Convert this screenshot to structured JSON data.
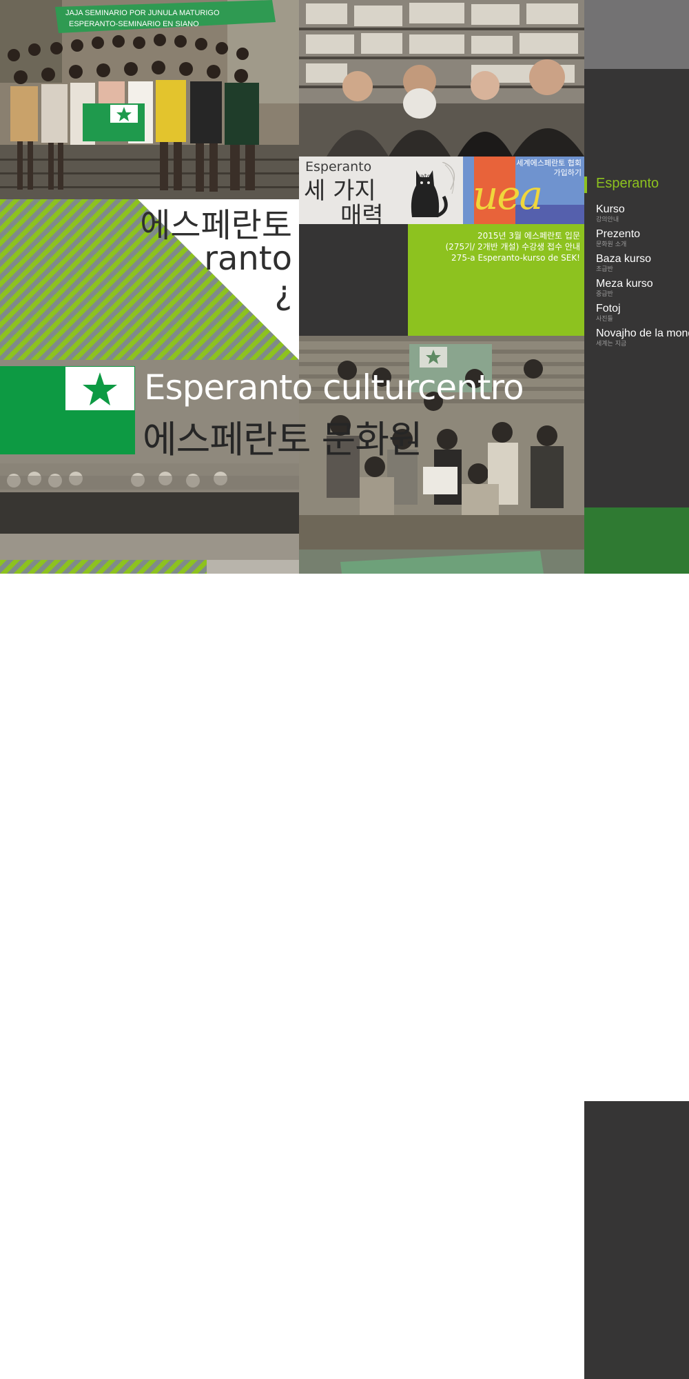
{
  "group_photo": {
    "banner_text_line1": "JAJA SEMINARIO POR JUNULA MATURIGO",
    "banner_text_line2": "ESPERANTO-SEMINARIO EN SIANO"
  },
  "tile_three": {
    "latin": "Esperanto",
    "korean_line1": "세 가지",
    "korean_line2": "매력",
    "cat_caption": "kato"
  },
  "tile_uea": {
    "logo_text": "uea",
    "korean_line1": "세계에스페란토 협회",
    "korean_line2": "가입하기"
  },
  "tile_course": {
    "line1": "2015년 3월 에스페란토 입문",
    "line2": "(275기/ 2개반 개설) 수강생 접수 안내",
    "line3": "275-a Esperanto-kurso de SEK!"
  },
  "tile_stripes": {
    "line1": "에스페란토",
    "line2": "ranto",
    "line3": "¿"
  },
  "hero": {
    "title": "Esperanto culturcentro",
    "subtitle": "에스페란토 문화원"
  },
  "sidebar": {
    "brand": "Esperanto",
    "items": [
      {
        "label": "Kurso",
        "sub": "강의안내"
      },
      {
        "label": "Prezento",
        "sub": "문화원 소개"
      },
      {
        "label": "Baza kurso",
        "sub": "초급반"
      },
      {
        "label": "Meza kurso",
        "sub": "중급반"
      },
      {
        "label": "Fotoj",
        "sub": "사진들"
      },
      {
        "label": "Novajho de la mondo",
        "sub": "세계는 지금"
      }
    ]
  },
  "colors": {
    "accent_green": "#8dc21f",
    "flag_green": "#0d9a43",
    "sidebar_dark": "#363535"
  }
}
